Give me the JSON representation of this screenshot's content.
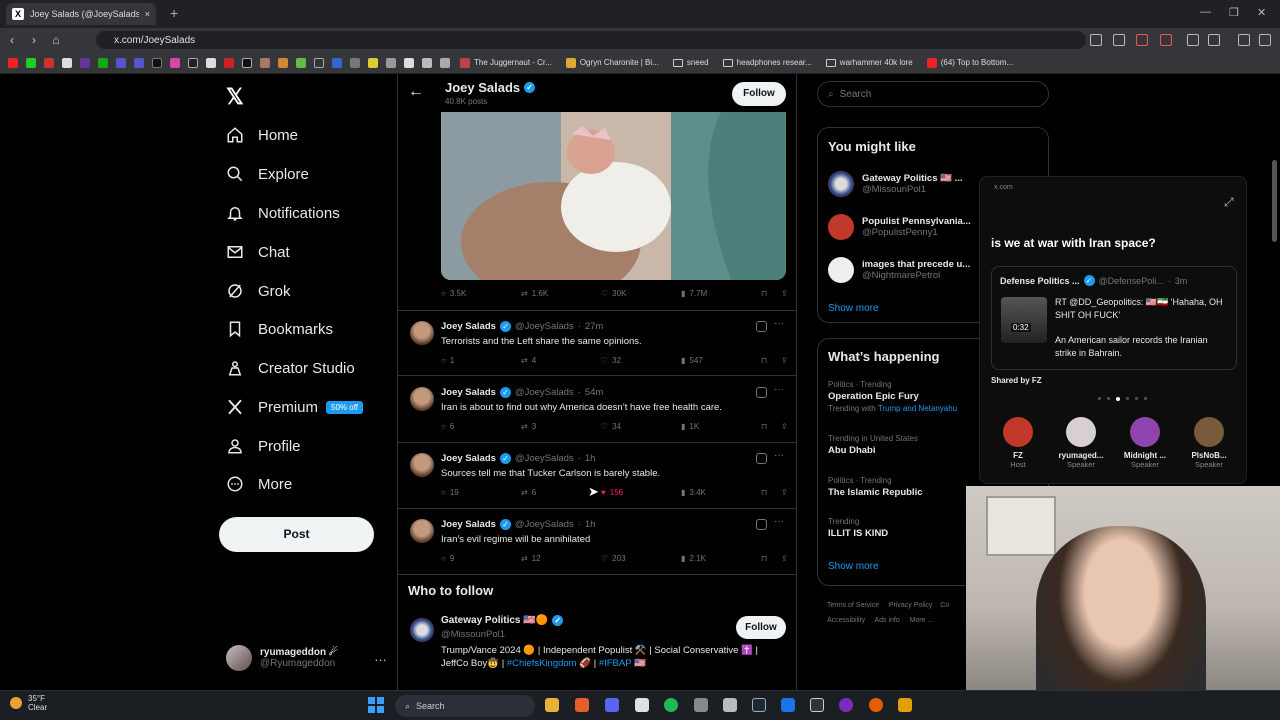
{
  "browser": {
    "tab_title": "Joey Salads (@JoeySalads) / X",
    "url": "x.com/JoeySalads",
    "bookmarks": [
      "The Juggernaut - Cr...",
      "Ogryn Charonite | Bi...",
      "sneed",
      "headphones resear...",
      "warhammer 40k lore",
      "(64) Top to Bottom..."
    ]
  },
  "nav": {
    "items": [
      "Home",
      "Explore",
      "Notifications",
      "Chat",
      "Grok",
      "Bookmarks",
      "Creator Studio",
      "Premium",
      "Profile",
      "More"
    ],
    "premium_badge": "50% off",
    "post_label": "Post",
    "me_name": "ryumageddon ☄",
    "me_handle": "@Ryumageddon",
    "me_more": "…"
  },
  "profile": {
    "name": "Joey Salads",
    "posts_count": "40.8K posts",
    "follow_label": "Follow",
    "pinned_stats": {
      "replies": "3.5K",
      "reposts": "1.6K",
      "likes": "30K",
      "views": "7.7M"
    }
  },
  "tweets": [
    {
      "name": "Joey Salads",
      "handle": "@JoeySalads",
      "time": "27m",
      "text": "Terrorists and the Left share the same opinions.",
      "replies": "1",
      "reposts": "4",
      "likes": "32",
      "views": "547"
    },
    {
      "name": "Joey Salads",
      "handle": "@JoeySalads",
      "time": "54m",
      "text": "Iran is about to find out why America doesn’t have free health care.",
      "replies": "6",
      "reposts": "3",
      "likes": "34",
      "views": "1K"
    },
    {
      "name": "Joey Salads",
      "handle": "@JoeySalads",
      "time": "1h",
      "text": "Sources tell me that Tucker Carlson is barely stable.",
      "replies": "19",
      "reposts": "6",
      "likes": "156",
      "views": "3.4K"
    },
    {
      "name": "Joey Salads",
      "handle": "@JoeySalads",
      "time": "1h",
      "text": "Iran’s evil regime will be annihilated",
      "replies": "9",
      "reposts": "12",
      "likes": "203",
      "views": "2.1K"
    }
  ],
  "who_to_follow": {
    "title": "Who to follow",
    "name": "Gateway Politics 🇺🇸🟠",
    "handle": "@MissouriPol1",
    "follow_label": "Follow",
    "bio_line1": "Trump/Vance 2024 🟠 | Independent Populist ⚒️ | Social Conservative ✝️ |",
    "bio_line2_prefix": "JeffCo Boy🤠 | ",
    "bio_link1": "#ChiefsKingdom",
    "bio_mid": " 🏈 | ",
    "bio_link2": "#IFBAP",
    "bio_suffix": " 🇺🇸"
  },
  "right": {
    "search_placeholder": "Search",
    "you_might_like": "You might like",
    "suggestions": [
      {
        "name": "Gateway Politics 🇺🇸 ...",
        "handle": "@MissouriPol1"
      },
      {
        "name": "Populist Pennsylvania...",
        "handle": "@PopulistPenny1"
      },
      {
        "name": "images that precede u...",
        "handle": "@NightmarePetrol"
      }
    ],
    "show_more": "Show more",
    "whats_happening": "What’s happening",
    "trends": [
      {
        "context": "Politics · Trending",
        "title": "Operation Epic Fury",
        "sub_prefix": "Trending with ",
        "sub_links": "Trump and Netanyahu"
      },
      {
        "context": "Trending in United States",
        "title": "Abu Dhabi",
        "sub_prefix": "",
        "sub_links": ""
      },
      {
        "context": "Politics · Trending",
        "title": "The Islamic Republic",
        "sub_prefix": "",
        "sub_links": ""
      },
      {
        "context": "Trending",
        "title": "ILLIT IS KIND",
        "sub_prefix": "",
        "sub_links": ""
      }
    ],
    "footer": [
      "Terms of Service",
      "Privacy Policy",
      "Co",
      "Accessibility",
      "Ads info",
      "More …"
    ]
  },
  "space_overlay": {
    "host": "x.com",
    "question": "is we at war with Iran space?",
    "source_name": "Defense Politics ...",
    "source_handle": "@DefensePoli...",
    "source_time": "3m",
    "duration": "0:32",
    "text1": "RT @DD_Geopolitics: 🇺🇸🇮🇷 'Hahaha, OH SHIT OH FUCK'",
    "text2": "An American sailor records the Iranian strike in Bahrain.",
    "shared_by": "Shared by FZ",
    "speakers": [
      {
        "name": "FZ",
        "role": "Host",
        "color": "#c0392b"
      },
      {
        "name": "ryumaged...",
        "role": "Speaker",
        "color": "#d7cfd0"
      },
      {
        "name": "Midnight ...",
        "role": "Speaker",
        "color": "#8e44ad"
      },
      {
        "name": "PlsNoB...",
        "role": "Speaker",
        "color": "#7a5a3a"
      }
    ]
  },
  "taskbar": {
    "temp": "35°F",
    "condition": "Clear",
    "search": "Search"
  }
}
